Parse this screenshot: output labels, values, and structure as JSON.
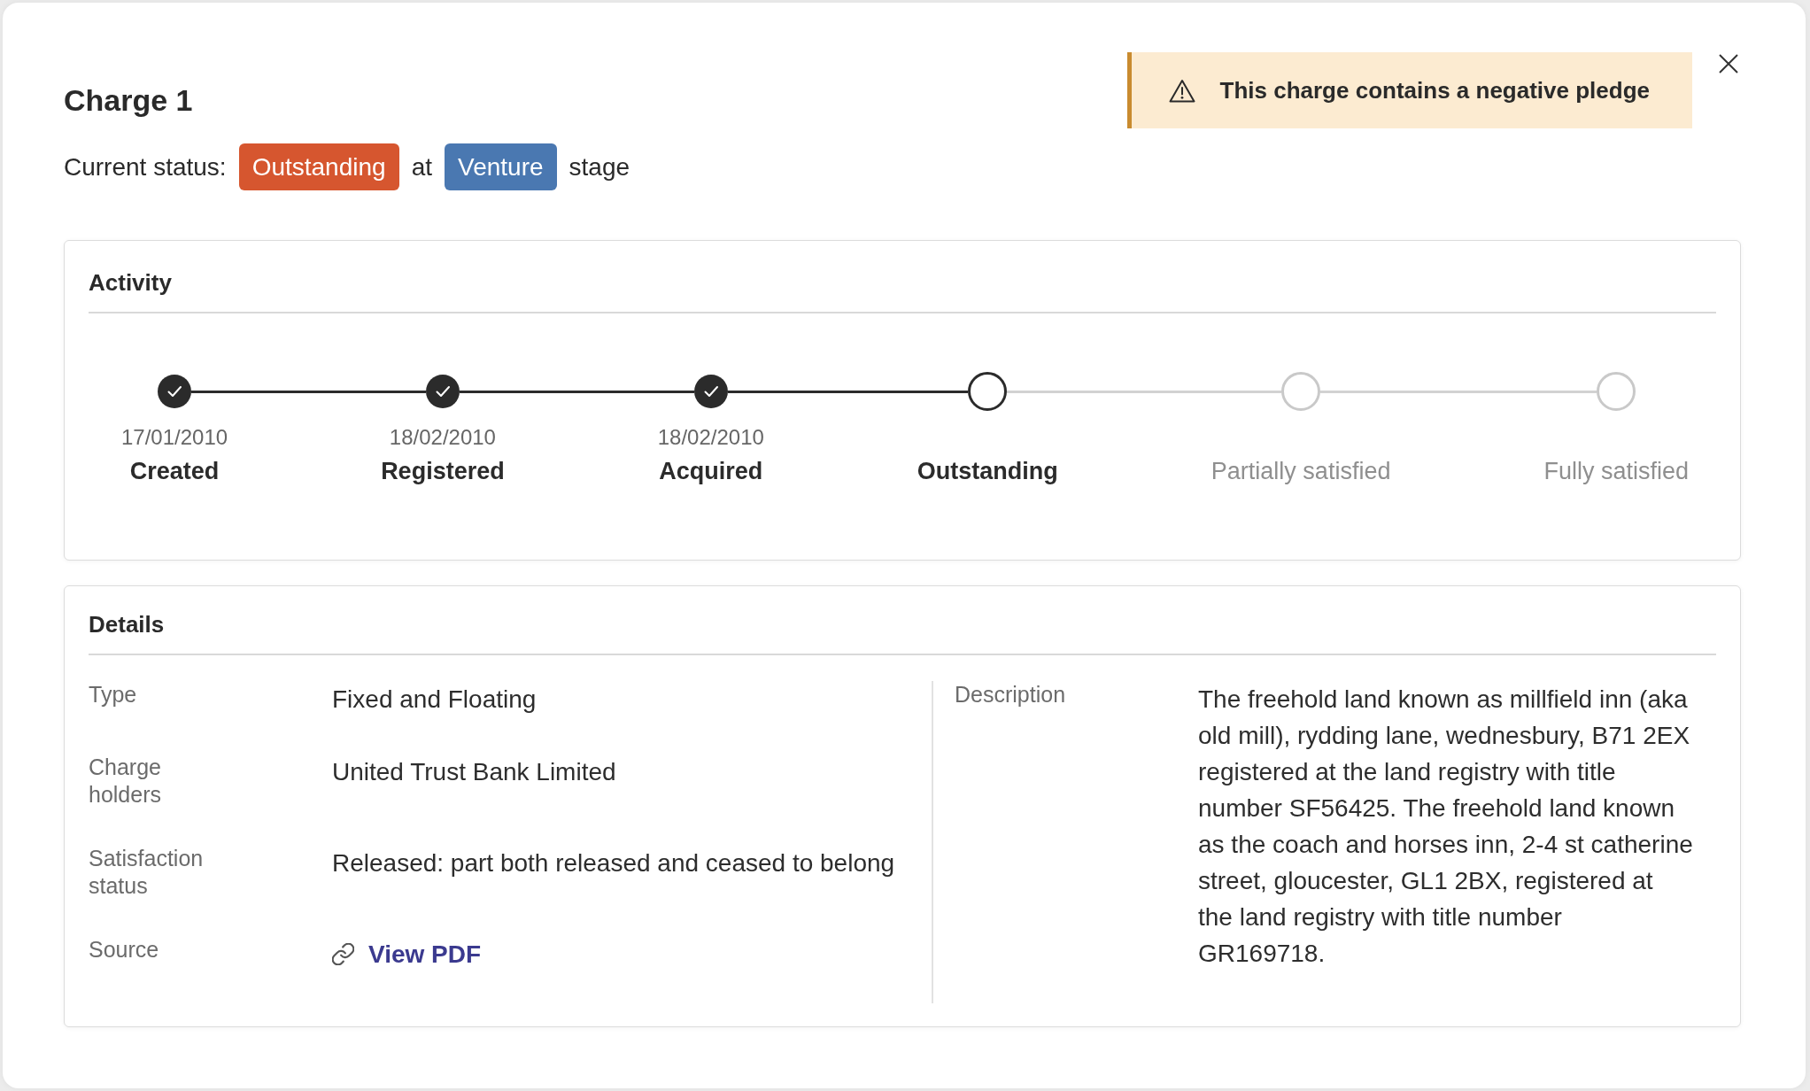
{
  "dialog": {
    "title": "Charge 1"
  },
  "status_line": [
    {
      "kind": "text",
      "text": "Current status:"
    },
    {
      "kind": "badge",
      "text": "Outstanding",
      "color": "#d6562f"
    },
    {
      "kind": "text",
      "text": "at"
    },
    {
      "kind": "badge",
      "text": "Venture",
      "color": "#4a78b1"
    },
    {
      "kind": "text",
      "text": "stage"
    }
  ],
  "alert": {
    "text": "This charge contains a negative pledge"
  },
  "activity": {
    "title": "Activity",
    "steps": [
      {
        "name": "Created",
        "date": "17/01/2010",
        "completed": true,
        "current": false
      },
      {
        "name": "Registered",
        "date": "18/02/2010",
        "completed": true,
        "current": false
      },
      {
        "name": "Acquired",
        "date": "18/02/2010",
        "completed": true,
        "current": false
      },
      {
        "name": "Outstanding",
        "completed": false,
        "current": true
      },
      {
        "name": "Partially satisfied",
        "completed": false,
        "current": false
      },
      {
        "name": "Fully satisfied",
        "completed": false,
        "current": false
      }
    ]
  },
  "details": {
    "title": "Details",
    "fields": [
      {
        "kind": "text",
        "label": "Type",
        "value": "Fixed and Floating"
      },
      {
        "kind": "text",
        "label": "Charge holders",
        "value": "United Trust Bank Limited"
      },
      {
        "kind": "text",
        "label": "Satisfaction status",
        "value": "Released: part both released and ceased to belong"
      },
      {
        "kind": "link",
        "label": "Source",
        "value": "View PDF"
      }
    ],
    "description": {
      "label": "Description",
      "value": "The freehold land known as millfield inn (aka old mill), rydding lane, wednesbury, B71 2EX registered at the land registry with title number SF56425. The freehold land known as the coach and horses inn, 2-4 st catherine street, gloucester, GL1 2BX, registered at the land registry with title number GR169718."
    }
  }
}
